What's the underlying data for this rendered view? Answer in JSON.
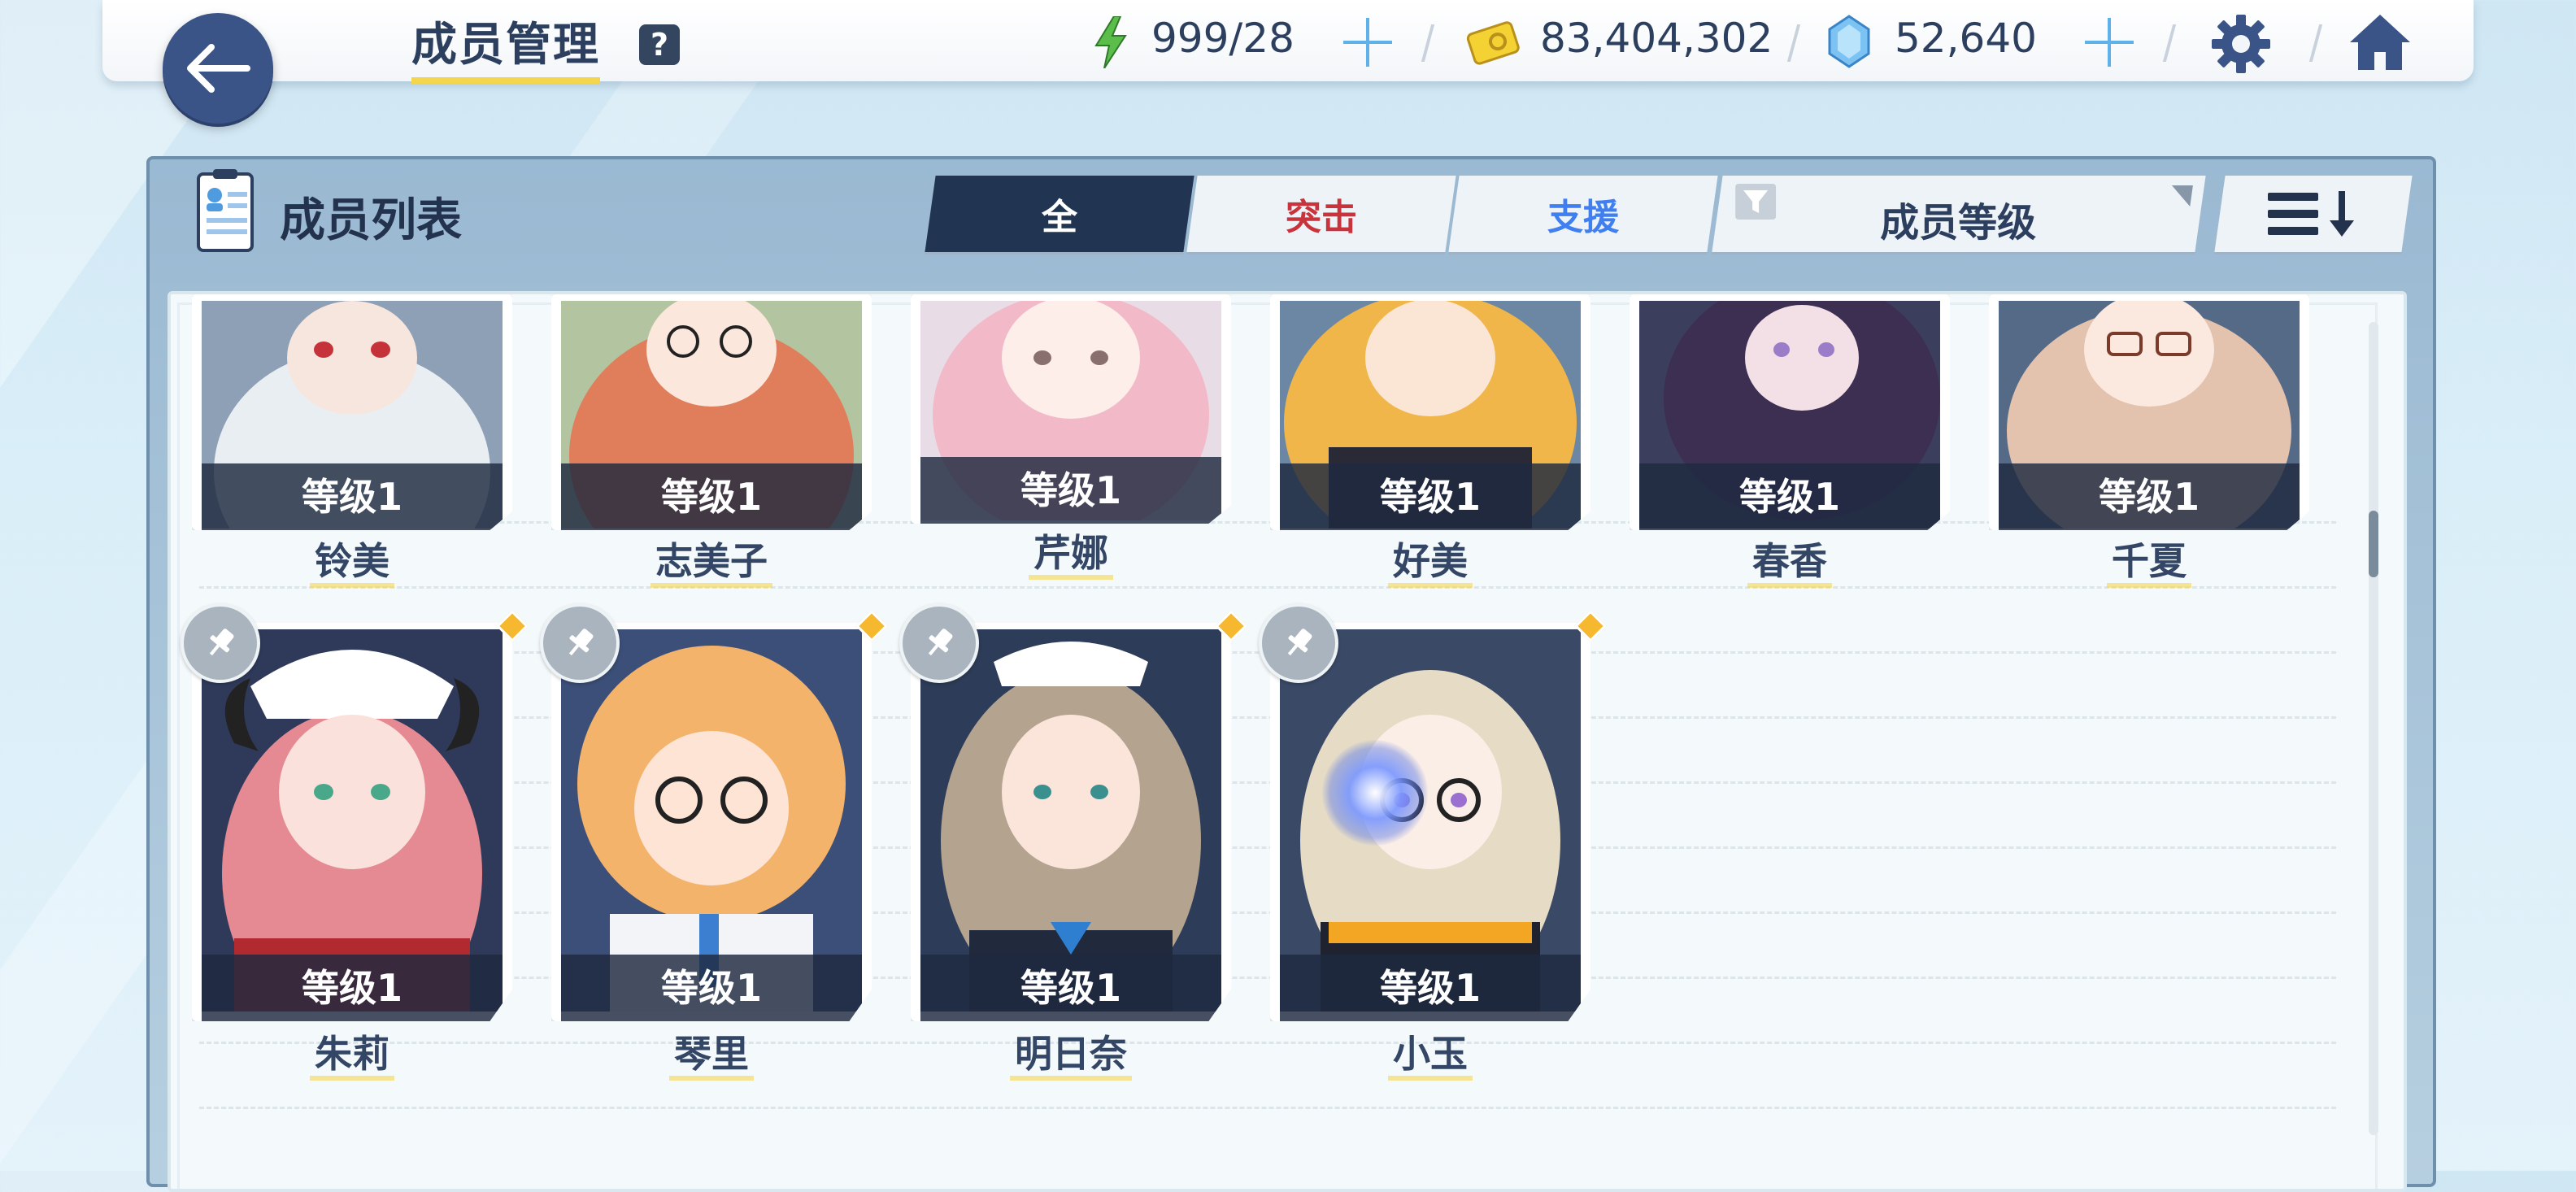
{
  "header": {
    "title": "成员管理",
    "help_label": "?",
    "ap": "999/28",
    "credits": "83,404,302",
    "pyroxene": "52,640"
  },
  "panel": {
    "title": "成员列表",
    "tabs": [
      {
        "label": "全",
        "active": true
      },
      {
        "label": "突击",
        "active": false
      },
      {
        "label": "支援",
        "active": false
      }
    ],
    "sort_label": "成员等级"
  },
  "members": [
    {
      "name": "铃美",
      "level": "等级1",
      "hair": "#e9eef3",
      "bg": "#8ea0b6"
    },
    {
      "name": "志美子",
      "level": "等级1",
      "hair": "#e07d5a",
      "bg": "#b3c5a0"
    },
    {
      "name": "芹娜",
      "level": "等级1",
      "hair": "#f2b9c8",
      "bg": "#e8dde6"
    },
    {
      "name": "好美",
      "level": "等级1",
      "hair": "#f0b64a",
      "bg": "#6b87a3"
    },
    {
      "name": "春香",
      "level": "等级1",
      "hair": "#3d2f52",
      "bg": "#3b3e5c"
    },
    {
      "name": "千夏",
      "level": "等级1",
      "hair": "#e3c2ae",
      "bg": "#546a86"
    },
    {
      "name": "朱莉",
      "level": "等级1",
      "hair": "#e58a93",
      "bg": "#2f3a5a"
    },
    {
      "name": "琴里",
      "level": "等级1",
      "hair": "#f4b36b",
      "bg": "#3c4f78"
    },
    {
      "name": "明日奈",
      "level": "等级1",
      "hair": "#b4a48f",
      "bg": "#2d3c58"
    },
    {
      "name": "小玉",
      "level": "等级1",
      "hair": "#e6dcc6",
      "bg": "#3a4966"
    }
  ],
  "colors": {
    "accent_dark": "#213552",
    "strike": "#c8333c",
    "support": "#3f7ff0",
    "underline": "#f3d64e",
    "gem": "#f5b82e"
  },
  "icons": [
    "back-arrow-icon",
    "lightning-icon",
    "credit-card-icon",
    "pyroxene-icon",
    "gear-icon",
    "home-icon",
    "filter-icon",
    "sort-order-icon",
    "pin-icon",
    "member-list-icon"
  ]
}
